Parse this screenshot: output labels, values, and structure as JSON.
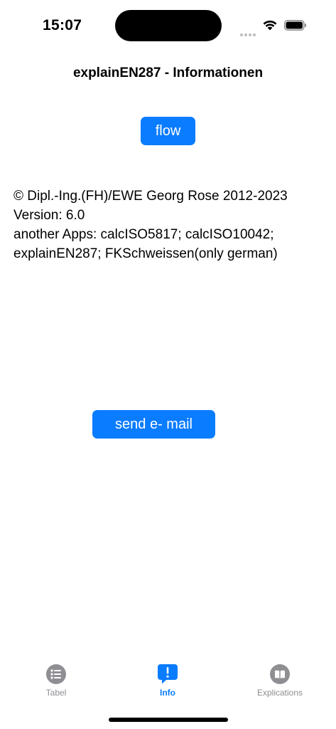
{
  "status_bar": {
    "time": "15:07"
  },
  "nav": {
    "title": "explainEN287 - Informationen"
  },
  "buttons": {
    "flow_label": "flow",
    "email_label": "send  e- mail"
  },
  "info": {
    "lines": [
      "© Dipl.-Ing.(FH)/EWE Georg Rose 2012-2023",
      "Version: 6.0",
      "another Apps: calcISO5817; calcISO10042;",
      "explainEN287; FKSchweissen(only german)"
    ]
  },
  "tab_bar": {
    "tabs": [
      {
        "label": "Tabel",
        "icon": "list-circle-icon",
        "active": false
      },
      {
        "label": "Info",
        "icon": "exclamation-bubble-icon",
        "active": true
      },
      {
        "label": "Explications",
        "icon": "book-circle-icon",
        "active": false
      }
    ]
  },
  "colors": {
    "accent": "#0a7cff",
    "inactive": "#8e8e93",
    "background": "#ffffff"
  }
}
